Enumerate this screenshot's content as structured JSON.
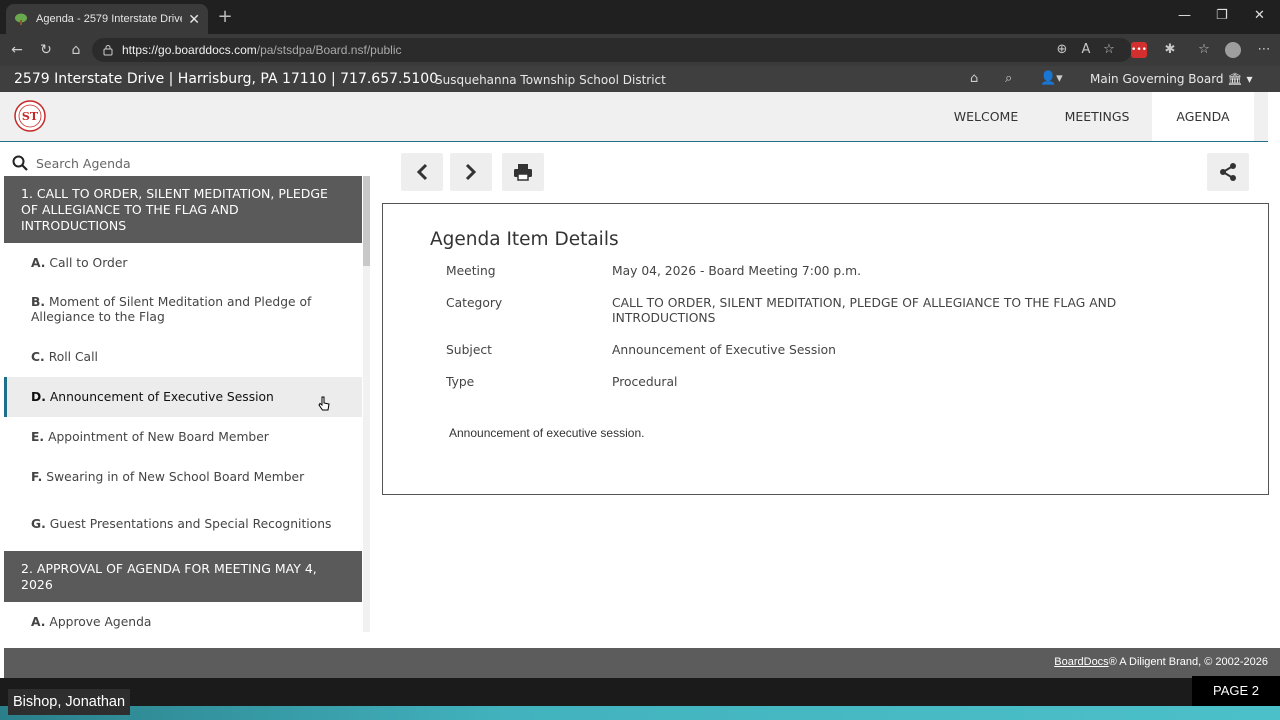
{
  "browser": {
    "tab_title": "Agenda - 2579 Interstate Drive | H",
    "tab_close": "✕",
    "new_tab": "+",
    "url_host": "https://go.boarddocs.com",
    "url_path": "/pa/stsdpa/Board.nsf/public",
    "window_controls": [
      "—",
      "❐",
      "✕"
    ]
  },
  "site": {
    "contact_line": "2579 Interstate Drive | Harrisburg, PA 17110 | 717.657.5100",
    "district_name": "Susquehanna Township School District",
    "board_select": "Main Governing Board",
    "logo_text": "ST"
  },
  "nav": {
    "items": [
      "WELCOME",
      "MEETINGS",
      "AGENDA"
    ],
    "active": "AGENDA"
  },
  "search": {
    "placeholder": "Search Agenda"
  },
  "sidebar": {
    "categories": [
      {
        "label": "1. CALL TO ORDER, SILENT MEDITATION, PLEDGE OF ALLEGIANCE TO THE FLAG AND INTRODUCTIONS",
        "items": [
          {
            "letter": "A.",
            "label": "Call to Order"
          },
          {
            "letter": "B.",
            "label": "Moment of Silent Meditation and Pledge of Allegiance to the Flag"
          },
          {
            "letter": "C.",
            "label": "Roll Call"
          },
          {
            "letter": "D.",
            "label": "Announcement of Executive Session"
          },
          {
            "letter": "E.",
            "label": "Appointment of New Board Member"
          },
          {
            "letter": "F.",
            "label": "Swearing in of New School Board Member"
          },
          {
            "letter": "G.",
            "label": "Guest Presentations and Special Recognitions"
          }
        ]
      },
      {
        "label": "2. APPROVAL OF AGENDA FOR MEETING MAY 4, 2026",
        "items": [
          {
            "letter": "A.",
            "label": "Approve Agenda"
          }
        ]
      }
    ]
  },
  "detail": {
    "heading": "Agenda Item Details",
    "rows": [
      {
        "label": "Meeting",
        "value": "May 04, 2026 - Board Meeting 7:00 p.m."
      },
      {
        "label": "Category",
        "value": "CALL TO ORDER, SILENT MEDITATION, PLEDGE OF ALLEGIANCE TO THE FLAG AND INTRODUCTIONS"
      },
      {
        "label": "Subject",
        "value": "Announcement of Executive Session"
      },
      {
        "label": "Type",
        "value": "Procedural"
      }
    ],
    "description": "Announcement of executive session."
  },
  "footer": {
    "brand_link": "BoardDocs",
    "copyright": "® A Diligent Brand, © 2002-2026"
  },
  "overlay": {
    "participant_name": "Bishop, Jonathan",
    "page_label": "PAGE 2"
  }
}
